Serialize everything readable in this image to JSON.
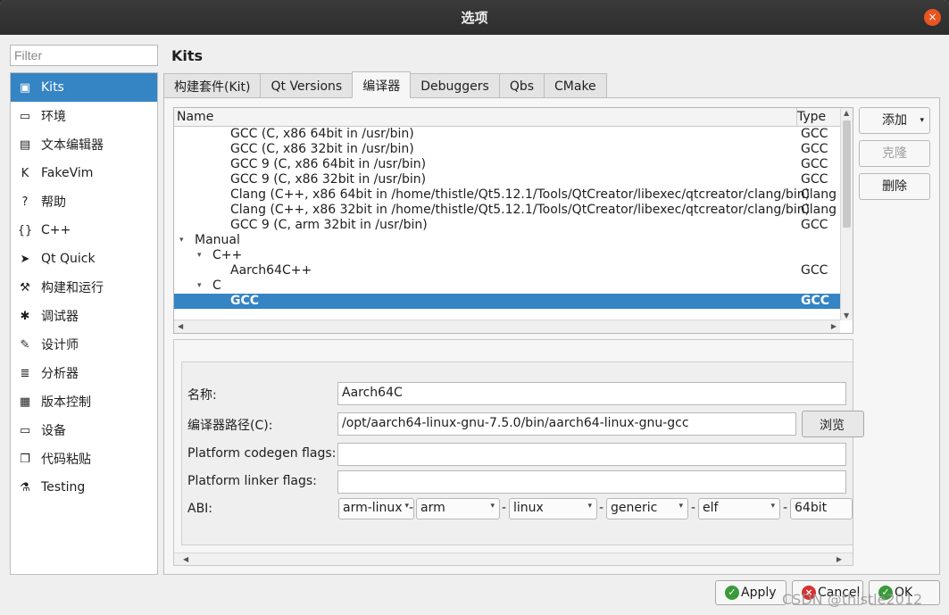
{
  "window": {
    "title": "选项",
    "close_glyph": "×"
  },
  "filter": {
    "placeholder": "Filter",
    "value": ""
  },
  "sidebar": {
    "items": [
      {
        "label": "Kits",
        "icon": "kits-icon",
        "glyph": "▣",
        "active": true
      },
      {
        "label": "环境",
        "icon": "monitor-icon",
        "glyph": "▭"
      },
      {
        "label": "文本编辑器",
        "icon": "text-editor-icon",
        "glyph": "▤"
      },
      {
        "label": "FakeVim",
        "icon": "fakevim-icon",
        "glyph": "K"
      },
      {
        "label": "帮助",
        "icon": "help-icon",
        "glyph": "?"
      },
      {
        "label": "C++",
        "icon": "braces-icon",
        "glyph": "{}"
      },
      {
        "label": "Qt Quick",
        "icon": "qt-quick-icon",
        "glyph": "➤"
      },
      {
        "label": "构建和运行",
        "icon": "hammer-icon",
        "glyph": "⚒"
      },
      {
        "label": "调试器",
        "icon": "bug-icon",
        "glyph": "✱"
      },
      {
        "label": "设计师",
        "icon": "pencil-icon",
        "glyph": "✎"
      },
      {
        "label": "分析器",
        "icon": "analyzer-icon",
        "glyph": "≣"
      },
      {
        "label": "版本控制",
        "icon": "version-control-icon",
        "glyph": "▦"
      },
      {
        "label": "设备",
        "icon": "device-icon",
        "glyph": "▭"
      },
      {
        "label": "代码粘贴",
        "icon": "paste-icon",
        "glyph": "❐"
      },
      {
        "label": "Testing",
        "icon": "testing-icon",
        "glyph": "⚗"
      }
    ]
  },
  "page": {
    "title": "Kits"
  },
  "tabs": [
    {
      "label": "构建套件(Kit)"
    },
    {
      "label": "Qt Versions"
    },
    {
      "label": "编译器",
      "active": true
    },
    {
      "label": "Debuggers"
    },
    {
      "label": "Qbs"
    },
    {
      "label": "CMake"
    }
  ],
  "compiler_tree": {
    "columns": {
      "name": "Name",
      "type": "Type"
    },
    "rows": [
      {
        "name": "GCC (C, x86 64bit in /usr/bin)",
        "type": "GCC",
        "level": 2
      },
      {
        "name": "GCC (C, x86 32bit in /usr/bin)",
        "type": "GCC",
        "level": 2
      },
      {
        "name": "GCC 9 (C, x86 64bit in /usr/bin)",
        "type": "GCC",
        "level": 2
      },
      {
        "name": "GCC 9 (C, x86 32bit in /usr/bin)",
        "type": "GCC",
        "level": 2
      },
      {
        "name": "Clang (C++, x86 64bit in /home/thistle/Qt5.12.1/Tools/QtCreator/libexec/qtcreator/clang/bin)",
        "type": "Clang",
        "level": 2
      },
      {
        "name": "Clang (C++, x86 32bit in /home/thistle/Qt5.12.1/Tools/QtCreator/libexec/qtcreator/clang/bin)",
        "type": "Clang",
        "level": 2
      },
      {
        "name": "GCC 9 (C, arm 32bit in /usr/bin)",
        "type": "GCC",
        "level": 2
      },
      {
        "name": "Manual",
        "type": "",
        "level": 0,
        "expanded": true
      },
      {
        "name": "C++",
        "type": "",
        "level": 1,
        "expanded": true
      },
      {
        "name": "Aarch64C++",
        "type": "GCC",
        "level": 2
      },
      {
        "name": "C",
        "type": "",
        "level": 1,
        "expanded": true
      },
      {
        "name": "GCC",
        "type": "GCC",
        "level": 2,
        "selected": true
      }
    ]
  },
  "buttons": {
    "add": "添加",
    "clone": "克隆",
    "remove": "删除"
  },
  "detail": {
    "name_label": "名称:",
    "name_value": "Aarch64C",
    "path_label": "编译器路径(C):",
    "path_value": "/opt/aarch64-linux-gnu-7.5.0/bin/aarch64-linux-gnu-gcc",
    "browse": "浏览",
    "codegen_label": "Platform codegen flags:",
    "codegen_value": "",
    "linker_label": "Platform linker flags:",
    "linker_value": "",
    "abi_label": "ABI:",
    "abi": [
      "arm-linux",
      "arm",
      "linux",
      "generic",
      "elf",
      "64bit"
    ]
  },
  "footer": {
    "apply": "Apply",
    "cancel": "Cancel",
    "ok": "OK"
  },
  "watermark": "CSDN @thistle2012",
  "colors": {
    "selection": "#3584c4",
    "title_bar": "#2d2d2d",
    "close": "#e95420"
  }
}
